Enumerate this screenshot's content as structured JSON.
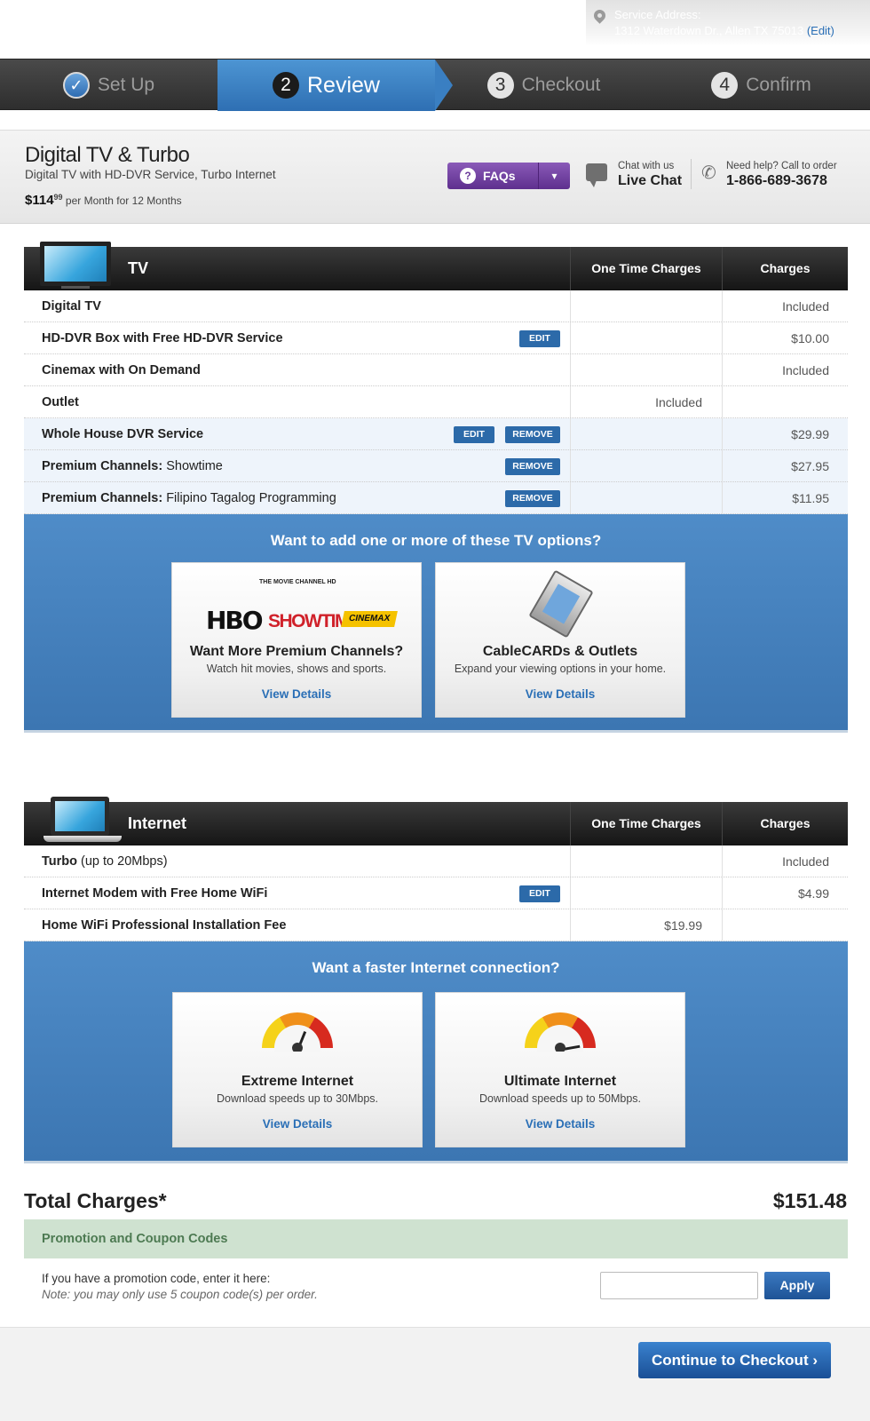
{
  "service_address": {
    "label": "Service Address:",
    "address": "1312 Waterdown Dr., Allen TX 75013",
    "edit_label": "(Edit)"
  },
  "steps": [
    {
      "num": "✓",
      "label": "Set Up",
      "state": "done"
    },
    {
      "num": "2",
      "label": "Review",
      "state": "active"
    },
    {
      "num": "3",
      "label": "Checkout",
      "state": "inactive"
    },
    {
      "num": "4",
      "label": "Confirm",
      "state": "inactive"
    }
  ],
  "package": {
    "title": "Digital TV & Turbo",
    "subtitle": "Digital TV with HD-DVR Service, Turbo Internet",
    "price_main": "$114",
    "price_cents": "99",
    "price_terms": "per Month for 12 Months",
    "faqs_label": "FAQs",
    "chat_small": "Chat with us",
    "chat_big": "Live Chat",
    "phone_small": "Need help? Call to order",
    "phone_big": "1-866-689-3678"
  },
  "tv": {
    "title": "TV",
    "col_one_time": "One Time Charges",
    "col_charges": "Charges",
    "rows": [
      {
        "name": "Digital TV",
        "detail": "",
        "one_time": "",
        "charge": "Included"
      },
      {
        "name": "HD-DVR Box with Free HD-DVR Service",
        "detail": "",
        "one_time": "",
        "charge": "$10.00",
        "edit": "EDIT"
      },
      {
        "name": "Cinemax with On Demand",
        "detail": "",
        "one_time": "",
        "charge": "Included"
      },
      {
        "name": "Outlet",
        "detail": "",
        "one_time": "Included",
        "charge": ""
      },
      {
        "name": "Whole House DVR Service",
        "detail": "",
        "one_time": "",
        "charge": "$29.99",
        "edit": "EDIT",
        "remove": "REMOVE"
      },
      {
        "name": "Premium Channels:",
        "detail": "Showtime",
        "one_time": "",
        "charge": "$27.95",
        "remove": "REMOVE"
      },
      {
        "name": "Premium Channels:",
        "detail": "Filipino Tagalog Programming",
        "one_time": "",
        "charge": "$11.95",
        "remove": "REMOVE"
      }
    ],
    "upsell_heading": "Want to add one or more of these TV options?",
    "cards": [
      {
        "title": "Want More Premium Channels?",
        "desc": "Watch hit movies, shows and sports.",
        "link": "View Details"
      },
      {
        "title": "CableCARDs & Outlets",
        "desc": "Expand your viewing options in your home.",
        "link": "View Details"
      }
    ],
    "logos": {
      "tmc": "THE MOVIE CHANNEL HD",
      "hbo": "HBO",
      "showtime": "SHOWTIME",
      "cinemax": "CINEMAX"
    }
  },
  "internet": {
    "title": "Internet",
    "col_one_time": "One Time Charges",
    "col_charges": "Charges",
    "rows": [
      {
        "name": "Turbo",
        "detail": "(up to 20Mbps)",
        "one_time": "",
        "charge": "Included"
      },
      {
        "name": "Internet Modem with Free Home WiFi",
        "detail": "",
        "one_time": "",
        "charge": "$4.99",
        "edit": "EDIT"
      },
      {
        "name": "Home WiFi Professional Installation Fee",
        "detail": "",
        "one_time": "$19.99",
        "charge": ""
      }
    ],
    "upsell_heading": "Want a faster Internet connection?",
    "cards": [
      {
        "title": "Extreme Internet",
        "desc": "Download speeds up to 30Mbps.",
        "link": "View Details"
      },
      {
        "title": "Ultimate Internet",
        "desc": "Download speeds up to 50Mbps.",
        "link": "View Details"
      }
    ]
  },
  "totals": {
    "label": "Total Charges*",
    "value": "$151.48"
  },
  "promo": {
    "bar_label": "Promotion and Coupon Codes",
    "prompt": "If you have a promotion code, enter it here:",
    "note": "Note: you may only use 5 coupon code(s) per order.",
    "input_value": "",
    "apply_label": "Apply"
  },
  "continue_label": "Continue to Checkout ›",
  "colors": {
    "accent_blue": "#2e6fb3",
    "faqs_purple": "#6a3a9a",
    "promo_green": "#cfe2d0"
  }
}
